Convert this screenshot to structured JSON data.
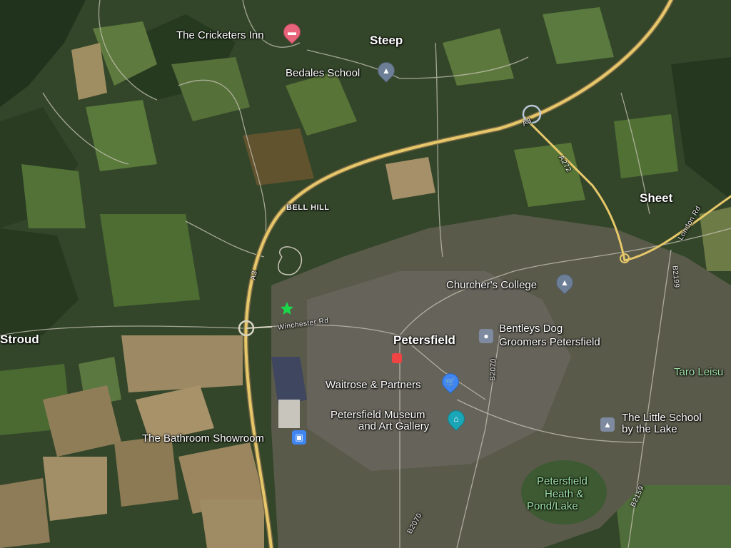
{
  "places": {
    "steep": "Steep",
    "sheet": "Sheet",
    "stroud": "Stroud",
    "petersfield": "Petersfield"
  },
  "pois": {
    "cricketers": "The Cricketers Inn",
    "bedales": "Bedales School",
    "churchers": "Churcher's College",
    "bentleys_line1": "Bentleys Dog",
    "bentleys_line2": "Groomers Petersfield",
    "waitrose": "Waitrose & Partners",
    "museum_line1": "Petersfield Museum",
    "museum_line2": "and Art Gallery",
    "bathroom": "The Bathroom Showroom",
    "little_school_line1": "The Little School",
    "little_school_line2": "by the Lake",
    "heath_line1": "Petersfield",
    "heath_line2": "Heath &",
    "heath_line3": "Pond/Lake",
    "taro": "Taro Leisu"
  },
  "roads": {
    "bell_hill": "BELL HILL",
    "winchester_rd": "Winchester Rd",
    "a3_north": "A3",
    "a3_west": "A3",
    "a272": "A272",
    "london_rd": "London Rd",
    "b2199": "B2199",
    "b2070_a": "B2070",
    "b2070_b": "B2070",
    "b2159": "B2159"
  },
  "icons": {
    "cricketers": "bed-icon",
    "bedales": "school-icon",
    "churchers": "school-icon",
    "bentleys": "generic-place-icon",
    "waitrose": "shopping-cart-icon",
    "museum": "museum-icon",
    "bathroom": "shop-icon",
    "little_school": "school-icon",
    "transit": "rail-station-icon",
    "selected": "green-marker-icon"
  },
  "colors": {
    "major_road": "#e6c86a",
    "pin_pink": "#e8647b",
    "pin_school": "#6c7f96",
    "pin_shop": "#3f86f2",
    "pin_museum": "#1aa6b7",
    "marker": "#19d94a"
  }
}
